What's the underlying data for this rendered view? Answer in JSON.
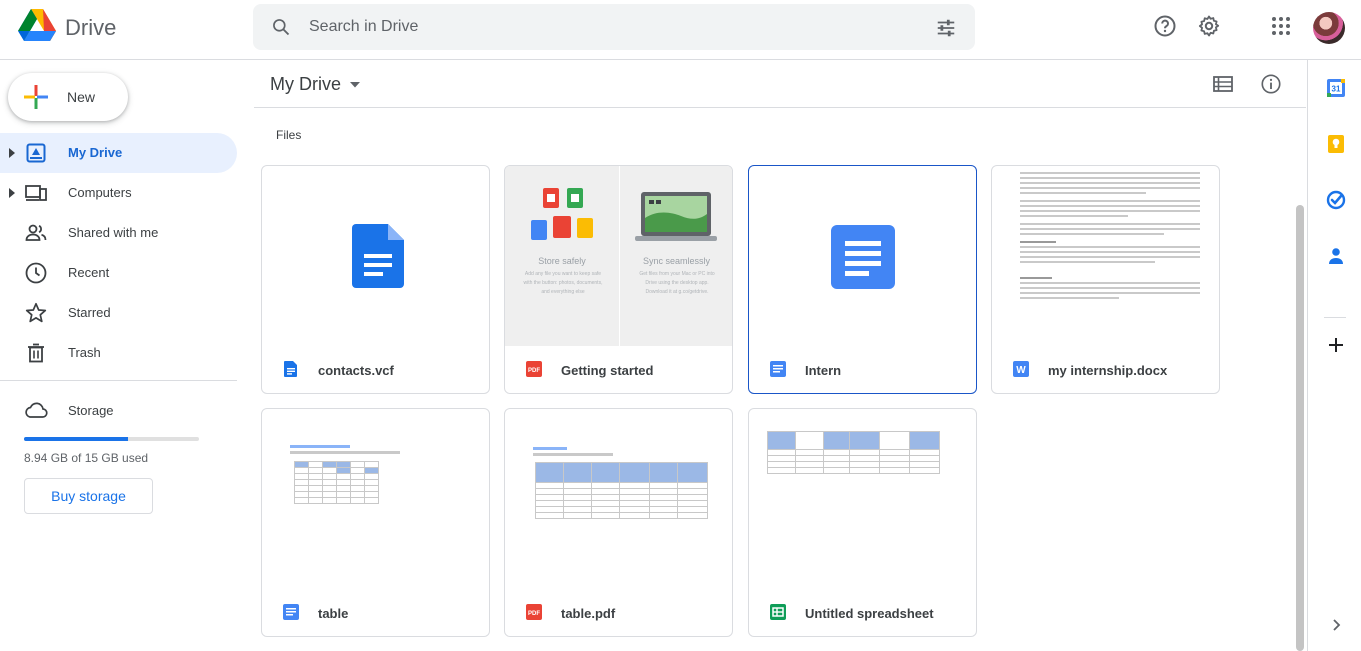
{
  "app": {
    "name": "Drive"
  },
  "search": {
    "placeholder": "Search in Drive"
  },
  "sidebar": {
    "new_label": "New",
    "items": [
      {
        "label": "My Drive",
        "active": true
      },
      {
        "label": "Computers",
        "active": false
      },
      {
        "label": "Shared with me",
        "active": false
      },
      {
        "label": "Recent",
        "active": false
      },
      {
        "label": "Starred",
        "active": false
      },
      {
        "label": "Trash",
        "active": false
      }
    ],
    "storage": {
      "label": "Storage",
      "used_text": "8.94 GB of 15 GB used",
      "used_fraction": 0.596,
      "buy_label": "Buy storage"
    }
  },
  "main": {
    "title": "My Drive",
    "section_label": "Files",
    "files": [
      {
        "name": "contacts.vcf",
        "icon": "docs-icon"
      },
      {
        "name": "Getting started",
        "icon": "pdf-icon"
      },
      {
        "name": "Intern",
        "icon": "docs-icon",
        "selected": true
      },
      {
        "name": "my internship.docx",
        "icon": "word-icon"
      },
      {
        "name": "table",
        "icon": "docs-icon"
      },
      {
        "name": "table.pdf",
        "icon": "pdf-icon"
      },
      {
        "name": "Untitled spreadsheet",
        "icon": "sheets-icon"
      }
    ],
    "getting_started": {
      "left_title": "Store safely",
      "left_text": "Add any file you want to keep safe with the button: photos, documents, and everything else",
      "right_title": "Sync seamlessly",
      "right_text": "Get files from your Mac or PC into Drive using the desktop app. Download it at g.co/getdrive."
    }
  },
  "rail": {
    "calendar_day": "31"
  },
  "colors": {
    "accent": "#1a73e8",
    "active_bg": "#e8f0fe",
    "border": "#dadce0"
  }
}
